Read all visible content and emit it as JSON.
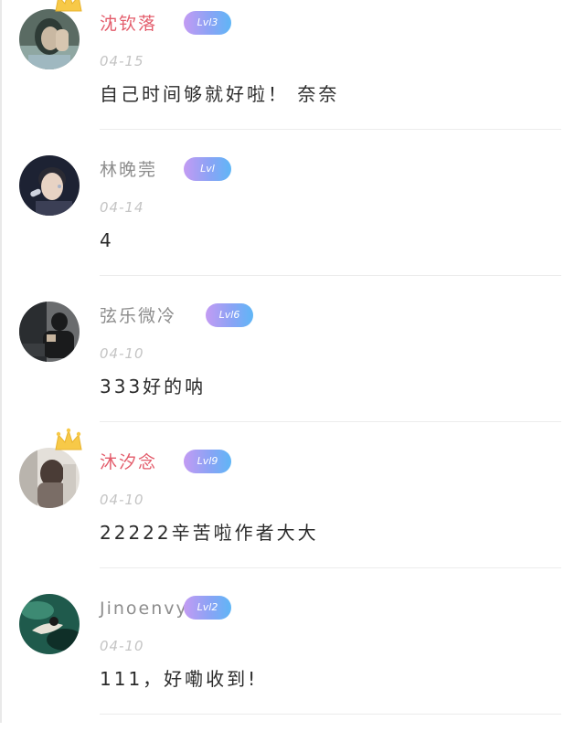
{
  "comments": [
    {
      "username": "沈钦落",
      "vip": true,
      "level": "Lvl3",
      "date": "04-15",
      "content": "自己时间够就好啦！ 奈奈",
      "avatar_icon": "girl-with-hand-avatar",
      "avatar_colors": [
        "#5a6b63",
        "#c9b8a2",
        "#2e3b36"
      ]
    },
    {
      "username": "林晚莞",
      "vip": false,
      "level": "Lvl",
      "date": "04-14",
      "content": "4",
      "avatar_icon": "singer-with-microphone-avatar",
      "avatar_colors": [
        "#1d2233",
        "#e8d3c4",
        "#3b3f55"
      ]
    },
    {
      "username": "弦乐微冷",
      "vip": false,
      "level": "Lvl6",
      "date": "04-10",
      "content": "333好的呐",
      "avatar_icon": "man-in-car-avatar",
      "avatar_colors": [
        "#2a2d30",
        "#6a6c6e",
        "#1a1b1c"
      ]
    },
    {
      "username": "沐汐念",
      "vip": true,
      "level": "Lvl9",
      "date": "04-10",
      "content": "22222辛苦啦作者大大",
      "avatar_icon": "girl-back-view-avatar",
      "avatar_colors": [
        "#b9b4ad",
        "#7a6d66",
        "#e4e0da"
      ]
    },
    {
      "username": "Jinoenvy",
      "vip": false,
      "level": "Lvl2",
      "date": "04-10",
      "content": "111，好嘞收到!",
      "avatar_icon": "woman-in-water-avatar",
      "avatar_colors": [
        "#1f5a4c",
        "#3d8a73",
        "#0f2f28"
      ]
    }
  ],
  "crown_icon": "crown-icon",
  "crown_color": "#f7c948",
  "vip_name_color": "#e35c6b",
  "name_color": "#8d8d8d"
}
